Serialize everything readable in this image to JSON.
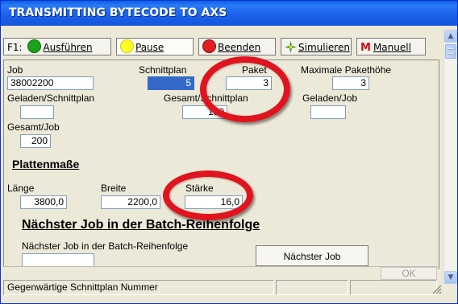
{
  "title": "TRANSMITTING BYTECODE TO AXS",
  "toolbar": {
    "f1": "F1:",
    "run": "Ausführen",
    "pause": "Pause",
    "stop": "Beenden",
    "simulate": "Simulieren",
    "manual_icon": "M",
    "manual": "Manuell"
  },
  "colors": {
    "run_dot": "#1aa31a",
    "pause_dot": "#ffff2a",
    "stop_dot": "#e02020",
    "highlight_oval": "#e0141e",
    "manual_icon": "#cc1111"
  },
  "form": {
    "job_label": "Job",
    "job_value": "38002200",
    "schnittplan_label": "Schnittplan",
    "schnittplan_value": "5",
    "paket_label": "Paket",
    "paket_value": "3",
    "max_paket_label": "Maximale Pakethöhe",
    "max_paket_value": "3",
    "geladen_schnittplan_label": "Geladen/Schnittplan",
    "geladen_schnittplan_value": "",
    "gesamt_schnittplan_label": "Gesamt/Schnittplan",
    "gesamt_schnittplan_value": "100",
    "geladen_job_label": "Geladen/Job",
    "geladen_job_value": "",
    "gesamt_job_label": "Gesamt/Job",
    "gesamt_job_value": "200",
    "plattenmasse_heading": "Plattenmaße",
    "laenge_label": "Länge",
    "laenge_value": "3800,0",
    "breite_label": "Breite",
    "breite_value": "2200,0",
    "staerke_label": "Stärke",
    "staerke_value": "16,0",
    "next_job_heading": "Nächster Job in der Batch-Reihenfolge",
    "next_job_label": "Nächster Job in der Batch-Reihenfolge",
    "next_job_value": "",
    "next_job_button": "Nächster Job",
    "ok_button": "OK"
  },
  "statusbar": {
    "text": "Gegenwärtige Schnittplan Nummer",
    "cell2": "",
    "cell3": ""
  },
  "icons": {
    "scroll_up": "scroll-up-icon",
    "scroll_down": "scroll-down-icon",
    "simulate": "sparkle-icon",
    "resize_grip": "resize-grip-icon"
  }
}
